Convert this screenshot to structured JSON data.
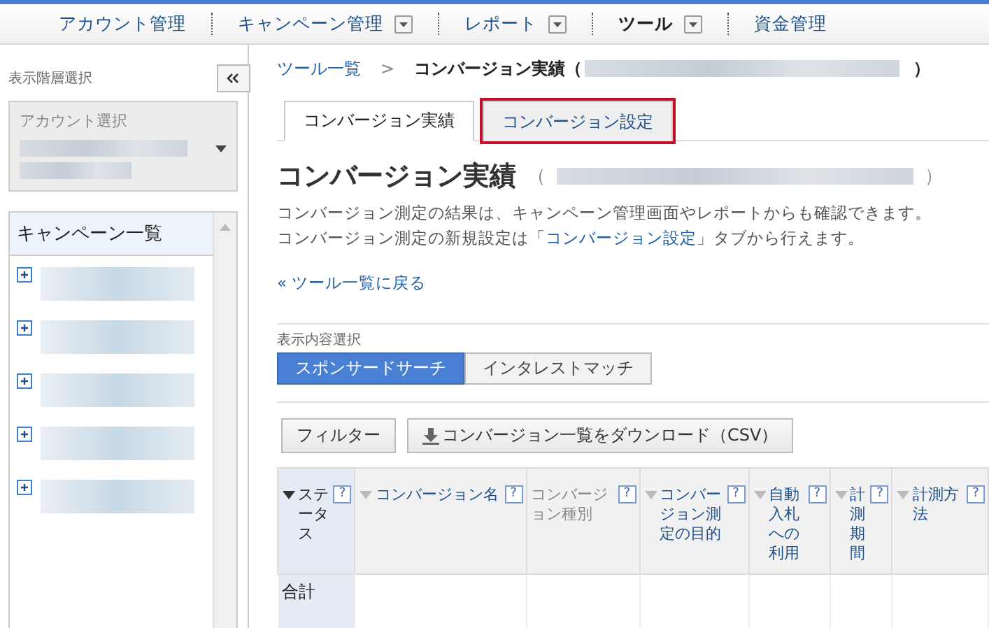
{
  "nav": [
    {
      "label": "アカウント管理",
      "dropdown": false,
      "selected": false
    },
    {
      "label": "キャンペーン管理",
      "dropdown": true,
      "selected": false
    },
    {
      "label": "レポート",
      "dropdown": true,
      "selected": false
    },
    {
      "label": "ツール",
      "dropdown": true,
      "selected": true
    },
    {
      "label": "資金管理",
      "dropdown": false,
      "selected": false
    }
  ],
  "sidebar": {
    "label": "表示階層選択",
    "account_select": {
      "label": "アカウント選択"
    },
    "campaign_panel": {
      "title": "キャンペーン一覧",
      "items": [
        {
          "expanded": false
        },
        {
          "expanded": false
        },
        {
          "expanded": false
        },
        {
          "expanded": false
        },
        {
          "expanded": false
        }
      ]
    }
  },
  "breadcrumb": {
    "link": "ツール一覧",
    "separator": ">",
    "current": "コンバージョン実績（",
    "close": "）"
  },
  "tabs": [
    {
      "label": "コンバージョン実績",
      "selected": true,
      "highlighted": false
    },
    {
      "label": "コンバージョン設定",
      "selected": false,
      "highlighted": true
    }
  ],
  "heading": {
    "title": "コンバージョン実績",
    "open": "（",
    "close": "）"
  },
  "description": [
    "コンバージョン測定の結果は、キャンペーン管理画面やレポートからも確認できます。",
    {
      "before": "コンバージョン測定の新規設定は「",
      "link": "コンバージョン設定",
      "after": "」タブから行えます。"
    }
  ],
  "back_link": "« ツール一覧に戻る",
  "display_select": {
    "label": "表示内容選択",
    "options": [
      {
        "label": "スポンサードサーチ",
        "selected": true
      },
      {
        "label": "インタレストマッチ",
        "selected": false
      }
    ]
  },
  "buttons": [
    {
      "label": "フィルター",
      "kind": "plain"
    },
    {
      "label": "コンバージョン一覧をダウンロード（CSV）",
      "kind": "download"
    }
  ],
  "table": {
    "columns": [
      {
        "label": "ステータス",
        "help": "?",
        "sortable": true,
        "sorted": true
      },
      {
        "label": "コンバージョン名",
        "help": "?",
        "sortable": true,
        "sorted": false
      },
      {
        "label": "コンバージョン種別",
        "help": "?",
        "sortable": false,
        "sorted": false
      },
      {
        "label": "コンバージョン測定の目的",
        "help": "?",
        "sortable": true,
        "sorted": false
      },
      {
        "label": "自動入札への利用",
        "help": "?",
        "sortable": true,
        "sorted": false
      },
      {
        "label": "計測期間",
        "help": "?",
        "sortable": true,
        "sorted": false
      },
      {
        "label": "計測方法",
        "help": "?",
        "sortable": true,
        "sorted": false
      }
    ],
    "rows": [
      [
        "合計"
      ]
    ]
  }
}
